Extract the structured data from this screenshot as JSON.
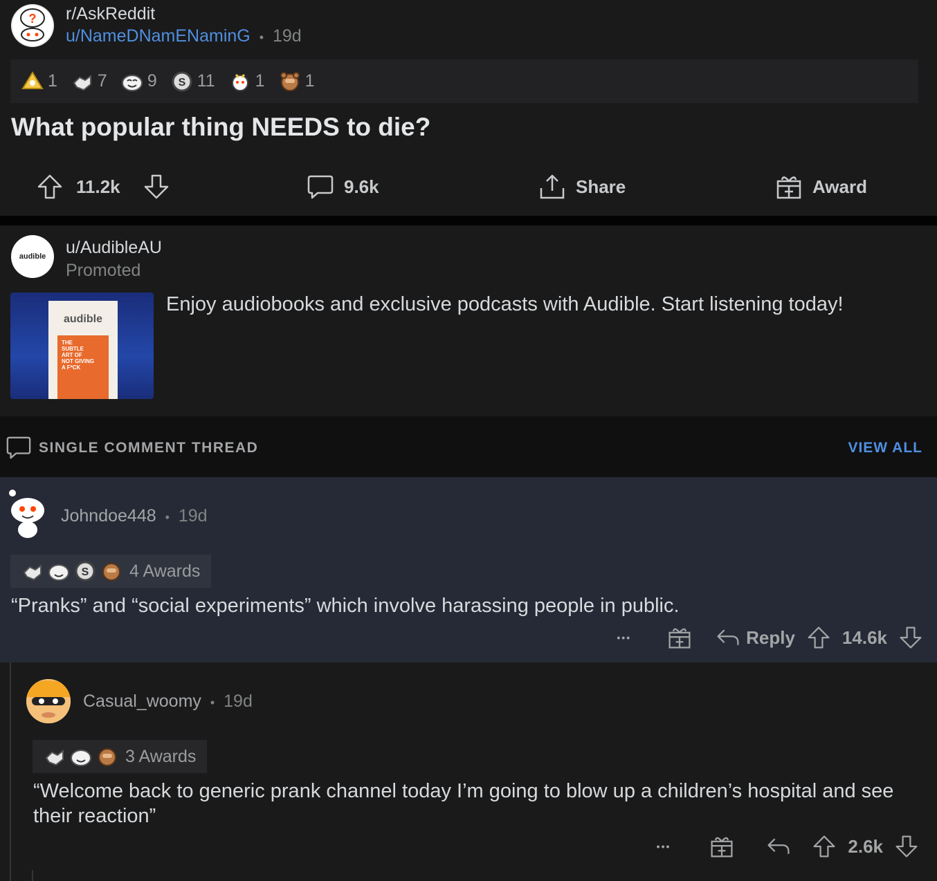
{
  "post": {
    "subreddit": "r/AskReddit",
    "author": "u/NameDNamENaminG",
    "dot": "•",
    "age": "19d",
    "awards": [
      {
        "icon": "wholesome-award-icon",
        "count": "1"
      },
      {
        "icon": "handshake-award-icon",
        "count": "7"
      },
      {
        "icon": "laughing-face-award-icon",
        "count": "9"
      },
      {
        "icon": "silver-coin-award-icon",
        "count": "11"
      },
      {
        "icon": "party-snoo-award-icon",
        "count": "1"
      },
      {
        "icon": "facepalm-bear-award-icon",
        "count": "1"
      }
    ],
    "title": "What popular thing NEEDS to die?",
    "votes": "11.2k",
    "comments": "9.6k",
    "share_label": "Share",
    "award_label": "Award"
  },
  "ad": {
    "author": "u/AudibleAU",
    "promoted_label": "Promoted",
    "avatar_text": "audible",
    "text": "Enjoy audiobooks and exclusive podcasts with Audible. Start listening today!",
    "book_brand": "audible",
    "book_title": "THE SUBTLE ART OF NOT GIVING A F*CK"
  },
  "thread_bar": {
    "label": "SINGLE COMMENT THREAD",
    "view_all": "VIEW ALL"
  },
  "comments": [
    {
      "author": "Johndoe448",
      "dot": "•",
      "age": "19d",
      "awards_label": "4 Awards",
      "body": "“Pranks” and “social experiments” which involve harassing people in public.",
      "more": "•••",
      "reply_label": "Reply",
      "votes": "14.6k"
    },
    {
      "author": "Casual_woomy",
      "dot": "•",
      "age": "19d",
      "awards_label": "3 Awards",
      "body": "“Welcome back to generic prank channel today I’m going to blow up a children’s hospital and see their reaction”",
      "more": "•••",
      "votes": "2.6k"
    }
  ],
  "colors": {
    "background": "#1a1a1b",
    "highlight_comment": "#262a36",
    "link_blue": "#4f8fe0",
    "muted": "#818384"
  }
}
